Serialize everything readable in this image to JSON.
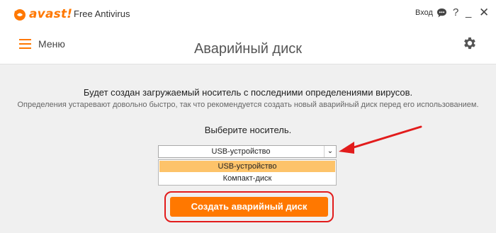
{
  "titlebar": {
    "brand": "avast!",
    "app_title": "Free Antivirus",
    "login_label": "Вход",
    "help_label": "?",
    "minimize_label": "_",
    "close_label": "✕"
  },
  "header": {
    "menu_label": "Меню",
    "page_title": "Аварийный диск"
  },
  "main": {
    "line1": "Будет создан загружаемый носитель с последними определениями вирусов.",
    "line2": "Определения устаревают довольно быстро, так что рекомендуется создать новый аварийный диск перед его использованием.",
    "choose_label": "Выберите носитель.",
    "select": {
      "value": "USB-устройство",
      "arrow": "⌄",
      "options": [
        "USB-устройство",
        "Компакт-диск"
      ],
      "highlighted_index": 0
    },
    "cta_label": "Создать аварийный диск"
  },
  "colors": {
    "accent": "#ff7800",
    "highlight": "#fdc36a",
    "annotation_red": "#e21c1c"
  },
  "icons": [
    "avast-logo-icon",
    "chat-icon",
    "help-icon",
    "minimize-icon",
    "close-icon",
    "hamburger-icon",
    "gear-icon",
    "chevron-down-icon",
    "red-arrow-annotation"
  ]
}
